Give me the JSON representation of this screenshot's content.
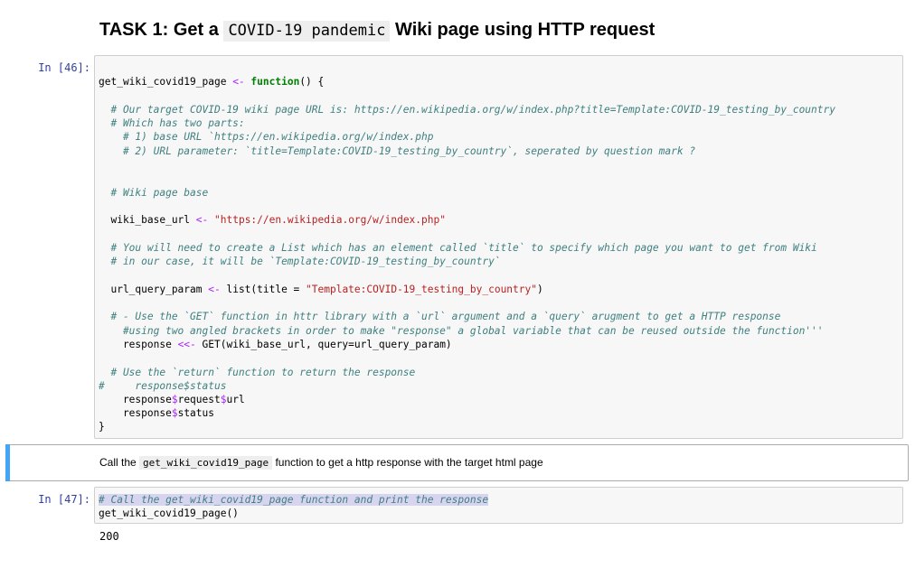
{
  "heading": {
    "prefix": "TASK 1: Get a ",
    "code": "COVID-19 pandemic",
    "suffix": " Wiki page using HTTP request"
  },
  "cell1": {
    "prompt": "In [46]:",
    "lines": {
      "l1a": "get_wiki_covid19_page ",
      "l1b": "<-",
      "l1c": " ",
      "l1d": "function",
      "l1e": "() {",
      "c1": "  # Our target COVID-19 wiki page URL is: https://en.wikipedia.org/w/index.php?title=Template:COVID-19_testing_by_country",
      "c2": "  # Which has two parts:",
      "c3": "    # 1) base URL `https://en.wikipedia.org/w/index.php",
      "c4": "    # 2) URL parameter: `title=Template:COVID-19_testing_by_country`, seperated by question mark ?",
      "c5": "  # Wiki page base",
      "w1": "  wiki_base_url ",
      "w2": "<-",
      "w3": " ",
      "w4": "\"https://en.wikipedia.org/w/index.php\"",
      "c6": "  # You will need to create a List which has an element called `title` to specify which page you want to get from Wiki",
      "c7": "  # in our case, it will be `Template:COVID-19_testing_by_country`",
      "u1": "  url_query_param ",
      "u2": "<-",
      "u3": " list(title = ",
      "u4": "\"Template:COVID-19_testing_by_country\"",
      "u5": ")",
      "c8": "  # - Use the `GET` function in httr library with a `url` argument and a `query` arugment to get a HTTP response",
      "c9": "    #using two angled brackets in order to make \"response\" a global variable that can be reused outside the function'''",
      "r1": "    response ",
      "r2": "<<-",
      "r3": " GET(wiki_base_url, query=url_query_param)",
      "c10": "  # Use the `return` function to return the response",
      "c11": "#     response$status",
      "q1": "    response",
      "q2": "$",
      "q3": "request",
      "q4": "$",
      "q5": "url",
      "s1": "    response",
      "s2": "$",
      "s3": "status",
      "end": "}"
    }
  },
  "md_cell": {
    "prefix": "Call the ",
    "code": "get_wiki_covid19_page",
    "suffix": " function to get a http response with the target html page"
  },
  "cell2": {
    "prompt": "In [47]:",
    "line1": "# Call the get_wiki_covid19_page function and print the response",
    "line2": "get_wiki_covid19_page()",
    "output": "200"
  },
  "colors": {
    "prompt": "#303f9f",
    "comment": "#408080",
    "keyword": "#008000",
    "string": "#ba2121",
    "operator": "#aa22ff",
    "selected_cell_bar": "#42a5f5"
  }
}
